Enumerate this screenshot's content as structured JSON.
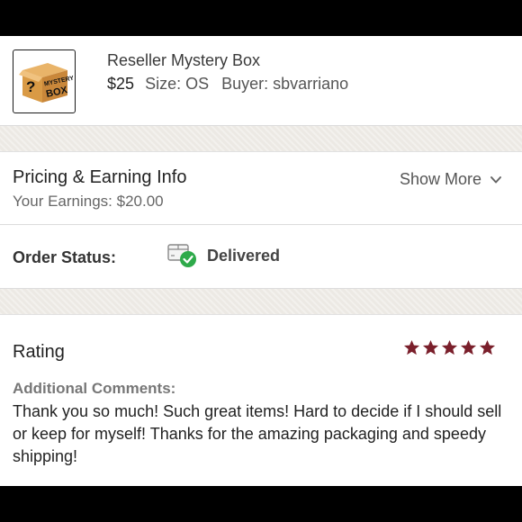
{
  "item": {
    "thumbnail_text_line1": "MYSTERY",
    "thumbnail_text_line2": "BOX",
    "thumbnail_mark": "?",
    "title": "Reseller Mystery Box",
    "price": "$25",
    "size": "Size: OS",
    "buyer": "Buyer: sbvarriano"
  },
  "pricing": {
    "title": "Pricing & Earning Info",
    "earnings": "Your Earnings: $20.00",
    "show_more_label": "Show More",
    "show_more_icon": "chevron-down-icon"
  },
  "order": {
    "label": "Order Status:",
    "status": "Delivered",
    "status_icon": "package-delivered-icon",
    "status_color": "#2eaa4a"
  },
  "rating": {
    "title": "Rating",
    "stars": 5,
    "max_stars": 5,
    "star_color": "#7a1f2b",
    "comments_label": "Additional Comments:",
    "comment": "Thank you so much! Such great items! Hard to decide if I should sell or keep for myself! Thanks for the amazing packaging and speedy shipping!"
  }
}
